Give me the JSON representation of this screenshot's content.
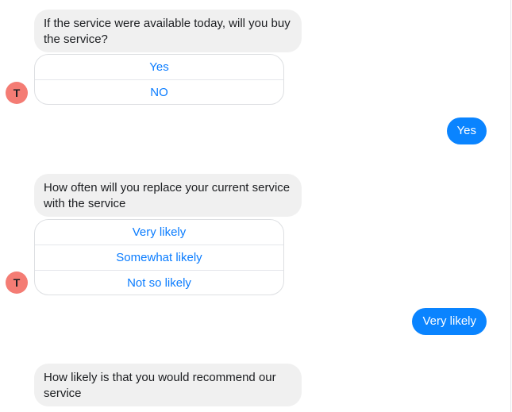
{
  "conversation": {
    "messages": [
      {
        "from": "bot",
        "text": "If the service were available today, will you buy the service?",
        "options": [
          "Yes",
          "NO"
        ]
      },
      {
        "from": "user",
        "text": "Yes"
      },
      {
        "from": "bot",
        "text": "How often will you replace your current service with the service",
        "options": [
          "Very likely",
          "Somewhat likely",
          "Not so likely"
        ]
      },
      {
        "from": "user",
        "text": "Very likely"
      },
      {
        "from": "bot",
        "text": "How likely is that you would recommend our service"
      }
    ],
    "avatar_letter": "T"
  },
  "colors": {
    "bot_bubble": "#f0f0f0",
    "user_bubble": "#0a84ff",
    "option_text": "#0a7cff",
    "avatar": "#f47c74"
  }
}
